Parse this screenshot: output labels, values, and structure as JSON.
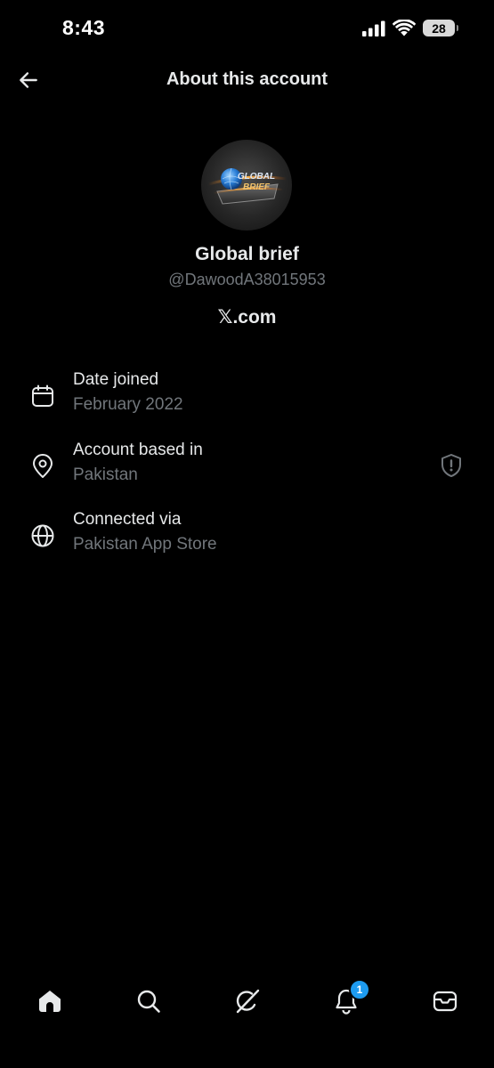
{
  "status_bar": {
    "time": "8:43",
    "battery": "28",
    "icons": [
      "cellular-signal-icon",
      "wifi-icon",
      "battery-icon"
    ]
  },
  "header": {
    "title": "About this account",
    "back_icon": "arrow-left-icon"
  },
  "profile": {
    "avatar_text_line1": "GLOBAL",
    "avatar_text_line2": "BRIEF",
    "display_name": "Global brief",
    "handle": "@DawoodA38015953",
    "domain_x": "𝕏",
    "domain_suffix": ".com"
  },
  "info": [
    {
      "icon": "calendar-icon",
      "label": "Date joined",
      "value": "February 2022"
    },
    {
      "icon": "location-pin-icon",
      "label": "Account based in",
      "value": "Pakistan",
      "extra_icon": "shield-alert-icon"
    },
    {
      "icon": "globe-icon",
      "label": "Connected via",
      "value": "Pakistan App Store"
    }
  ],
  "bottom_nav": {
    "items": [
      "home-icon",
      "search-icon",
      "grok-icon",
      "notifications-icon",
      "messages-icon"
    ],
    "notifications_badge": "1"
  },
  "colors": {
    "background": "#000000",
    "primary_text": "#e7e9ea",
    "secondary_text": "#71767b",
    "badge": "#1d9bf0"
  }
}
